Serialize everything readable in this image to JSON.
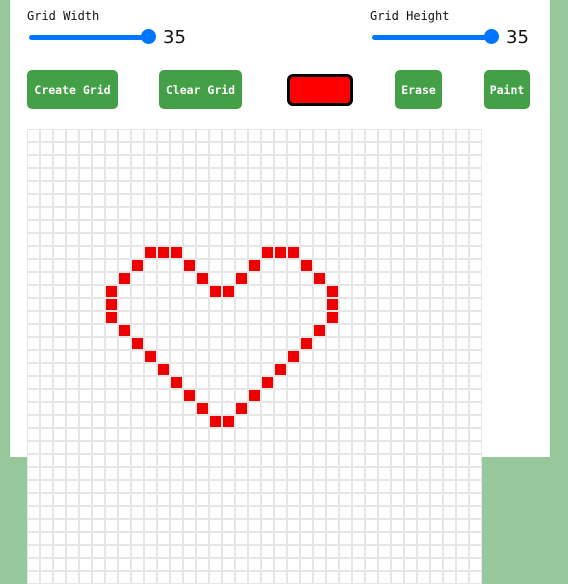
{
  "controls": {
    "width_label": "Grid Width",
    "width_value": "35",
    "height_label": "Grid Height",
    "height_value": "35"
  },
  "buttons": {
    "create_grid": "Create Grid",
    "clear_grid": "Clear Grid",
    "erase": "Erase",
    "paint": "Paint"
  },
  "colors": {
    "selected": "#ff0000",
    "painted": "#ee0000",
    "button": "#43a047",
    "background": "#97c89b"
  },
  "grid": {
    "columns": 35,
    "rows": 35,
    "painted_cells": [
      [
        9,
        9
      ],
      [
        9,
        10
      ],
      [
        9,
        11
      ],
      [
        9,
        18
      ],
      [
        9,
        19
      ],
      [
        9,
        20
      ],
      [
        10,
        8
      ],
      [
        10,
        12
      ],
      [
        10,
        17
      ],
      [
        10,
        21
      ],
      [
        11,
        7
      ],
      [
        11,
        13
      ],
      [
        11,
        16
      ],
      [
        11,
        22
      ],
      [
        12,
        6
      ],
      [
        12,
        14
      ],
      [
        12,
        15
      ],
      [
        12,
        23
      ],
      [
        13,
        6
      ],
      [
        13,
        23
      ],
      [
        14,
        6
      ],
      [
        14,
        23
      ],
      [
        15,
        7
      ],
      [
        15,
        22
      ],
      [
        16,
        8
      ],
      [
        16,
        21
      ],
      [
        17,
        9
      ],
      [
        17,
        20
      ],
      [
        18,
        10
      ],
      [
        18,
        19
      ],
      [
        19,
        11
      ],
      [
        19,
        18
      ],
      [
        20,
        12
      ],
      [
        20,
        17
      ],
      [
        21,
        13
      ],
      [
        21,
        16
      ],
      [
        22,
        14
      ],
      [
        22,
        15
      ]
    ]
  }
}
